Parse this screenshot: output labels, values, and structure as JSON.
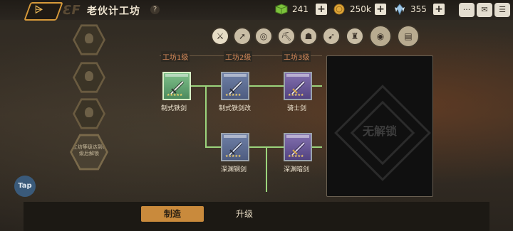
{
  "header": {
    "back_label": "⩥",
    "title": "老伙计工坊",
    "help_label": "?"
  },
  "resources": [
    {
      "name": "green-cube",
      "value": "241",
      "color": "#7cc23c"
    },
    {
      "name": "gold-coin",
      "value": "250k",
      "color": "#e0a83a"
    },
    {
      "name": "crystal",
      "value": "355",
      "color": "#9fc7e6"
    }
  ],
  "side": {
    "locked_text": "工坊等级达到6级后解锁",
    "tap_label": "Tap"
  },
  "tiers": [
    "工坊1级",
    "工坊2级",
    "工坊3级"
  ],
  "weapons": [
    {
      "label": "制式铁剑"
    },
    {
      "label": "制式铁剑改"
    },
    {
      "label": "骑士剑"
    },
    {
      "label": "深渊钢剑"
    },
    {
      "label": "深渊暗剑"
    }
  ],
  "unknown_panel": {
    "text": "无解锁"
  },
  "tabs": {
    "craft": "制造",
    "upgrade": "升级"
  },
  "colors": {
    "accent": "#c98a3c",
    "connector": "#9bd47c",
    "tier_text": "#d68a5a"
  }
}
